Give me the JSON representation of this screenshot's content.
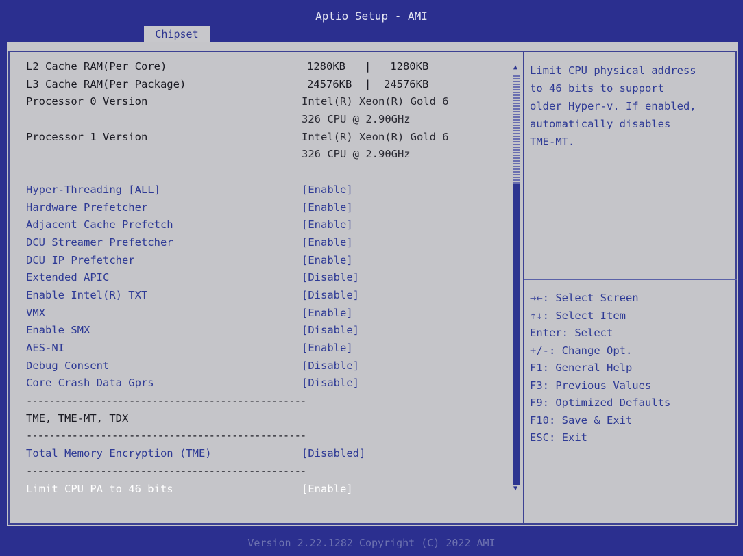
{
  "header": {
    "title": "Aptio Setup - AMI",
    "tab": "Chipset"
  },
  "info": [
    {
      "label": "L2 Cache RAM(Per Core)",
      "value": "1280KB   |   1280KB"
    },
    {
      "label": "L3 Cache RAM(Per Package)",
      "value": "24576KB  |  24576KB"
    },
    {
      "label": "Processor 0 Version",
      "value": "Intel(R) Xeon(R) Gold 6",
      "value2": "326 CPU @ 2.90GHz"
    },
    {
      "label": "Processor 1 Version",
      "value": "Intel(R) Xeon(R) Gold 6",
      "value2": "326 CPU @ 2.90GHz"
    }
  ],
  "settings": [
    {
      "label": "Hyper-Threading [ALL]",
      "value": "[Enable]"
    },
    {
      "label": "Hardware Prefetcher",
      "value": "[Enable]"
    },
    {
      "label": "Adjacent Cache Prefetch",
      "value": "[Enable]"
    },
    {
      "label": "DCU Streamer Prefetcher",
      "value": "[Enable]"
    },
    {
      "label": "DCU IP Prefetcher",
      "value": "[Enable]"
    },
    {
      "label": "Extended APIC",
      "value": "[Disable]"
    },
    {
      "label": "Enable Intel(R) TXT",
      "value": "[Disable]"
    },
    {
      "label": "VMX",
      "value": "[Enable]"
    },
    {
      "label": "Enable SMX",
      "value": "[Disable]"
    },
    {
      "label": "AES-NI",
      "value": "[Enable]"
    },
    {
      "label": "Debug Consent",
      "value": "[Disable]"
    },
    {
      "label": "Core Crash Data Gprs",
      "value": "[Disable]"
    }
  ],
  "separator": "-------------------------------------------------",
  "tme_heading": "TME, TME-MT, TDX",
  "tme": {
    "label": "Total Memory Encryption (TME)",
    "value": "[Disabled]"
  },
  "limit": {
    "label": "Limit CPU PA to 46 bits",
    "value": "[Enable]"
  },
  "help": [
    "Limit CPU physical address",
    "to 46 bits to support",
    "older Hyper-v. If enabled,",
    "automatically disables",
    "TME-MT."
  ],
  "keys": [
    "→←: Select Screen",
    "↑↓: Select Item",
    "Enter: Select",
    "+/-: Change Opt.",
    "F1: General Help",
    "F3: Previous Values",
    "F9: Optimized Defaults",
    "F10: Save & Exit",
    "ESC: Exit"
  ],
  "footer": "Version 2.22.1282 Copyright (C) 2022 AMI",
  "icons": {
    "scroll_up": "triangle-up-icon",
    "scroll_down": "triangle-down-icon"
  },
  "colors": {
    "frame": "#2b2f8f",
    "panel": "#c5c5c9",
    "menu_text": "#2e3a95",
    "selected_text": "#ffffff"
  }
}
